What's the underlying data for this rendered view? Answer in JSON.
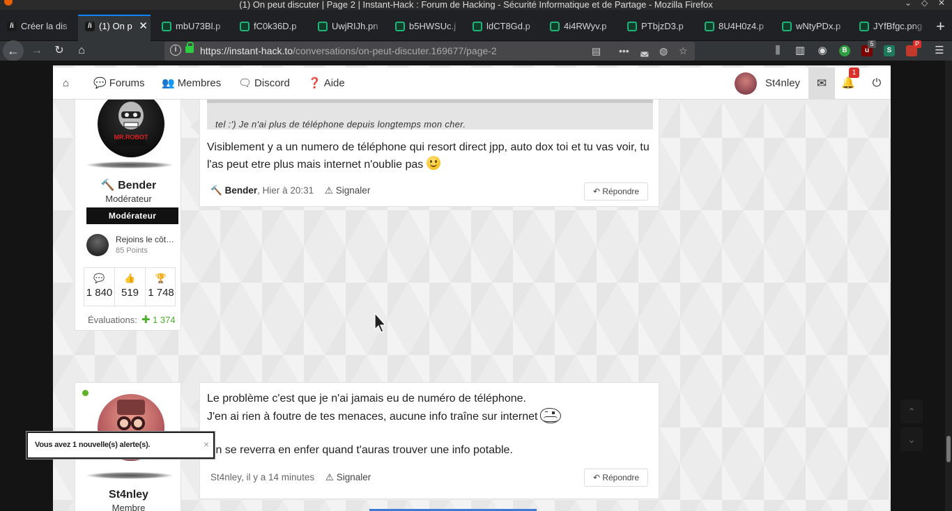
{
  "window": {
    "title": "(1) On peut discuter | Page 2 | Instant-Hack : Forum de Hacking - Sécurité Informatique et de Partage - Mozilla Firefox"
  },
  "tabs": [
    {
      "label": "Créer la dis",
      "icon": "instant-hack-favicon"
    },
    {
      "label": "(1) On p",
      "icon": "instant-hack-favicon",
      "active": true
    },
    {
      "label": "mbU73Bl.p",
      "icon": "image-favicon"
    },
    {
      "label": "fC0k36D.p",
      "icon": "image-favicon"
    },
    {
      "label": "UwjRIJh.pn",
      "icon": "image-favicon"
    },
    {
      "label": "b5HWSUc.j",
      "icon": "image-favicon"
    },
    {
      "label": "ldCT8Gd.p",
      "icon": "image-favicon"
    },
    {
      "label": "4i4RWyv.p",
      "icon": "image-favicon"
    },
    {
      "label": "PTbjzD3.p",
      "icon": "image-favicon"
    },
    {
      "label": "8U4H0z4.p",
      "icon": "image-favicon"
    },
    {
      "label": "wNtyPDx.p",
      "icon": "image-favicon"
    },
    {
      "label": "JYfBfgc.png",
      "icon": "image-favicon"
    }
  ],
  "navbar": {
    "url_domain": "https://instant-hack.to",
    "url_path": "/conversations/on-peut-discuter.169677/page-2",
    "ext_badge_1": "5",
    "ext_badge_2": "P"
  },
  "forum_nav": {
    "home_icon": "home-icon",
    "forums": "Forums",
    "members": "Membres",
    "discord": "Discord",
    "help": "Aide",
    "username": "St4nley",
    "notif_count": "1"
  },
  "post1": {
    "quote_text": "tel :') Je n'ai plus de téléphone depuis longtemps mon cher.",
    "body": "Visiblement y a un numero de téléphone qui resort direct jpp, auto dox toi et tu vas voir, tu l'as peut etre plus mais internet n'oublie pas",
    "author": "Bender",
    "time": ", Hier à 20:31",
    "report": "Signaler",
    "reply": "Répondre"
  },
  "user1": {
    "name": "Bender",
    "role": "Modérateur",
    "role_badge": "Modérateur",
    "avatar_text": "MR.ROBOT",
    "trophy_name": "Rejoins le côt…",
    "trophy_points": "85 Points",
    "stat_messages": "1 840",
    "stat_likes": "519",
    "stat_trophies": "1 748",
    "evals_label": "Évaluations:",
    "evals_value": "1 374"
  },
  "post2": {
    "line1": "Le problème c'est que je n'ai jamais eu de numéro de téléphone.",
    "line2": "J'en ai rien à foutre de tes menaces, aucune info traîne sur internet",
    "line3": "On se reverra en enfer quand t'auras trouver une info potable.",
    "author_time": "St4nley, il y a 14 minutes",
    "report": "Signaler",
    "reply": "Répondre"
  },
  "user2": {
    "name": "St4nley",
    "role": "Membre"
  },
  "toast": {
    "text": "Vous avez 1 nouvelle(s) alerte(s).",
    "close": "×"
  },
  "colors": {
    "accent": "#0a84ff",
    "online": "#61b02a",
    "evals": "#4caf2a",
    "notif": "#d9302c"
  }
}
